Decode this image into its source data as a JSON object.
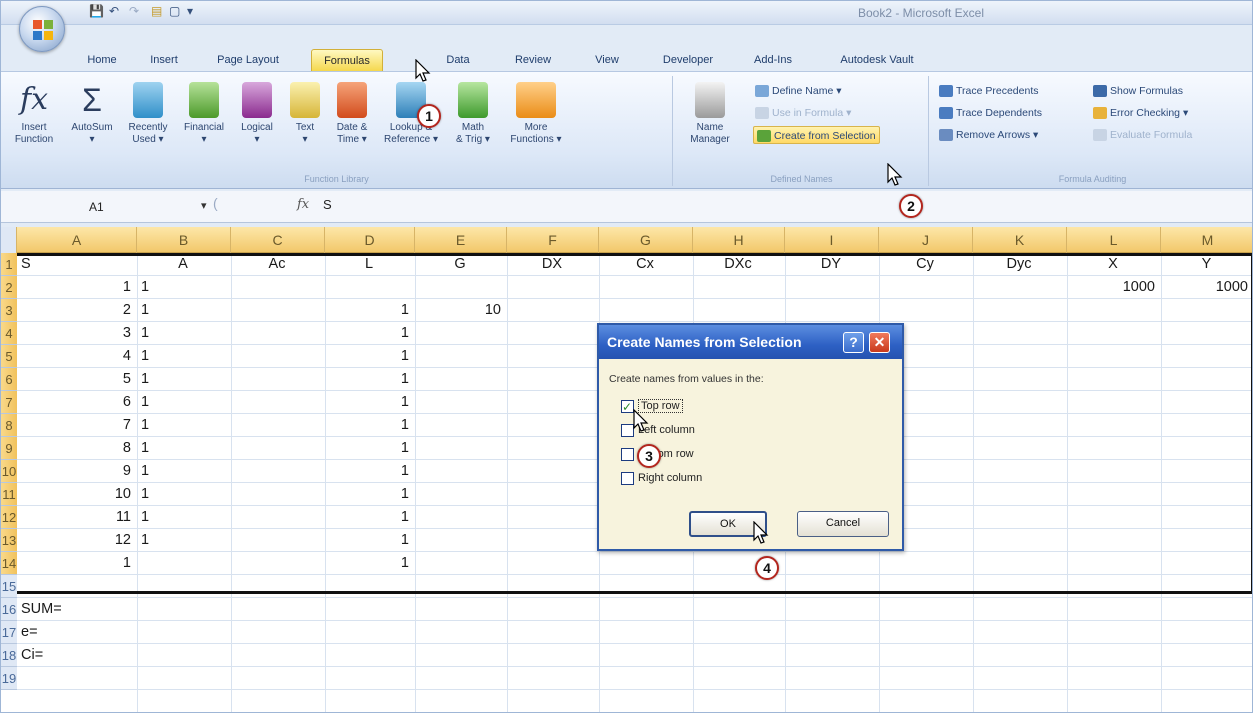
{
  "window": {
    "title": "Book2 - Microsoft Excel"
  },
  "tabs": [
    "Home",
    "Insert",
    "Page Layout",
    "Formulas",
    "Data",
    "Review",
    "View",
    "Developer",
    "Add-Ins",
    "Autodesk Vault"
  ],
  "active_tab": "Formulas",
  "ribbon": {
    "function_library": {
      "label": "Function Library",
      "buttons": [
        {
          "line1": "Insert",
          "line2": "Function",
          "icon": "fx-icon"
        },
        {
          "line1": "AutoSum",
          "line2": "▾",
          "icon": "sigma-icon"
        },
        {
          "line1": "Recently",
          "line2": "Used ▾",
          "icon": "book-blue-icon"
        },
        {
          "line1": "Financial",
          "line2": "▾",
          "icon": "book-green-icon"
        },
        {
          "line1": "Logical",
          "line2": "▾",
          "icon": "book-purple-icon"
        },
        {
          "line1": "Text",
          "line2": "▾",
          "icon": "book-text-icon"
        },
        {
          "line1": "Date &",
          "line2": "Time ▾",
          "icon": "book-red-icon"
        },
        {
          "line1": "Lookup &",
          "line2": "Reference ▾",
          "icon": "book-lookup-icon"
        },
        {
          "line1": "Math",
          "line2": "& Trig ▾",
          "icon": "book-math-icon"
        },
        {
          "line1": "More",
          "line2": "Functions ▾",
          "icon": "books-orange-icon"
        }
      ]
    },
    "defined_names": {
      "label": "Defined Names",
      "name_manager": {
        "line1": "Name",
        "line2": "Manager"
      },
      "define_name": "Define Name ▾",
      "use_in_formula": "Use in Formula ▾",
      "create_from_selection": "Create from Selection"
    },
    "formula_auditing": {
      "label": "Formula Auditing",
      "trace_precedents": "Trace Precedents",
      "trace_dependents": "Trace Dependents",
      "remove_arrows": "Remove Arrows ▾",
      "show_formulas": "Show Formulas",
      "error_checking": "Error Checking ▾",
      "evaluate_formula": "Evaluate Formula"
    }
  },
  "formula_bar": {
    "name_box": "A1",
    "fx": "fx",
    "content": "S"
  },
  "columns": [
    "A",
    "B",
    "C",
    "D",
    "E",
    "F",
    "G",
    "H",
    "I",
    "J",
    "K",
    "L",
    "M"
  ],
  "rows": [
    "1",
    "2",
    "3",
    "4",
    "5",
    "6",
    "7",
    "8",
    "9",
    "10",
    "11",
    "12",
    "13",
    "14",
    "15",
    "16",
    "17",
    "18",
    "19"
  ],
  "header_row": [
    "S",
    "A",
    "Ac",
    "L",
    "G",
    "DX",
    "Cx",
    "DXc",
    "DY",
    "Cy",
    "Dyc",
    "X",
    "Y"
  ],
  "col_a": [
    "1",
    "2",
    "3",
    "4",
    "5",
    "6",
    "7",
    "8",
    "9",
    "10",
    "11",
    "12",
    "1"
  ],
  "col_b": [
    "1",
    "1",
    "1",
    "1",
    "1",
    "1",
    "1",
    "1",
    "1",
    "1",
    "1",
    "1"
  ],
  "col_d": [
    "1",
    "1",
    "1",
    "1",
    "1",
    "1",
    "1",
    "1",
    "1",
    "1",
    "1",
    "1"
  ],
  "cell_e3": "10",
  "cell_l2": "1000",
  "cell_m2": "1000",
  "footer_labels": [
    "SUM=",
    "e=",
    "Ci="
  ],
  "dialog": {
    "title": "Create Names from Selection",
    "help": "?",
    "close": "✕",
    "prompt": "Create names from values in the:",
    "options": [
      {
        "label": "Top row",
        "checked": true
      },
      {
        "label": "Left column",
        "checked": false
      },
      {
        "label": "Bottom row",
        "checked": false
      },
      {
        "label": "Right column",
        "checked": false
      }
    ],
    "ok": "OK",
    "cancel": "Cancel"
  },
  "callouts": [
    "1",
    "2",
    "3",
    "4"
  ],
  "colors": {
    "accent_tab": "#f5d84e",
    "dialog_title": "#2d60c4",
    "callout_border": "#b3261e"
  }
}
